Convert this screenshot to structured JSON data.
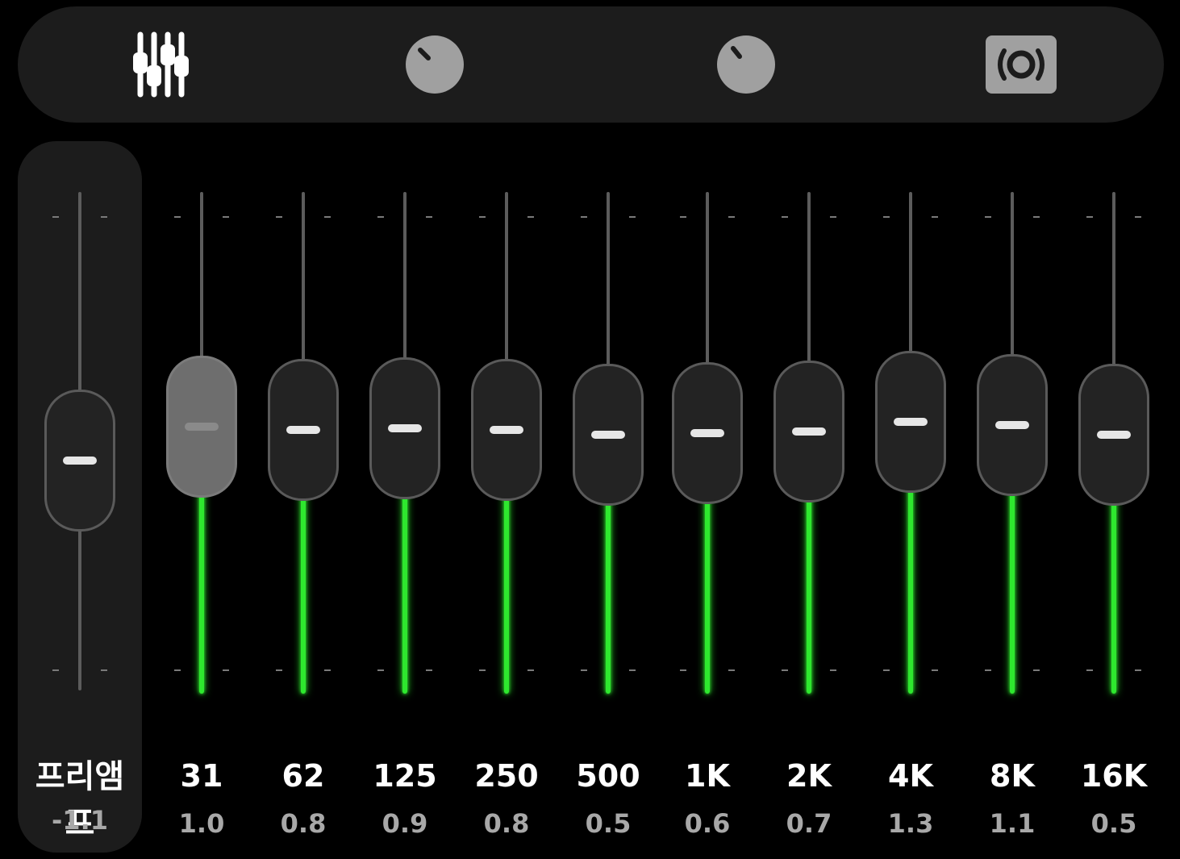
{
  "toolbar": {
    "tabs": [
      {
        "name": "equalizer",
        "icon": "equalizer-sliders-icon",
        "selected": true
      },
      {
        "name": "knob-1",
        "icon": "rotary-knob-icon",
        "selected": false
      },
      {
        "name": "knob-2",
        "icon": "rotary-knob-icon",
        "selected": false
      },
      {
        "name": "surround",
        "icon": "speaker-surround-icon",
        "selected": false
      }
    ]
  },
  "preamp": {
    "label": "프리앰프",
    "value": "-1.1",
    "level": -1.1
  },
  "bands": [
    {
      "freq": "31",
      "value": "1.0",
      "level": 1.0,
      "active": true
    },
    {
      "freq": "62",
      "value": "0.8",
      "level": 0.8
    },
    {
      "freq": "125",
      "value": "0.9",
      "level": 0.9
    },
    {
      "freq": "250",
      "value": "0.8",
      "level": 0.8
    },
    {
      "freq": "500",
      "value": "0.5",
      "level": 0.5
    },
    {
      "freq": "1K",
      "value": "0.6",
      "level": 0.6
    },
    {
      "freq": "2K",
      "value": "0.7",
      "level": 0.7
    },
    {
      "freq": "4K",
      "value": "1.3",
      "level": 1.3
    },
    {
      "freq": "8K",
      "value": "1.1",
      "level": 1.1
    },
    {
      "freq": "16K",
      "value": "0.5",
      "level": 0.5
    }
  ],
  "colors": {
    "accent": "#2ee82e",
    "panel": "#1c1c1c",
    "background": "#000000"
  }
}
